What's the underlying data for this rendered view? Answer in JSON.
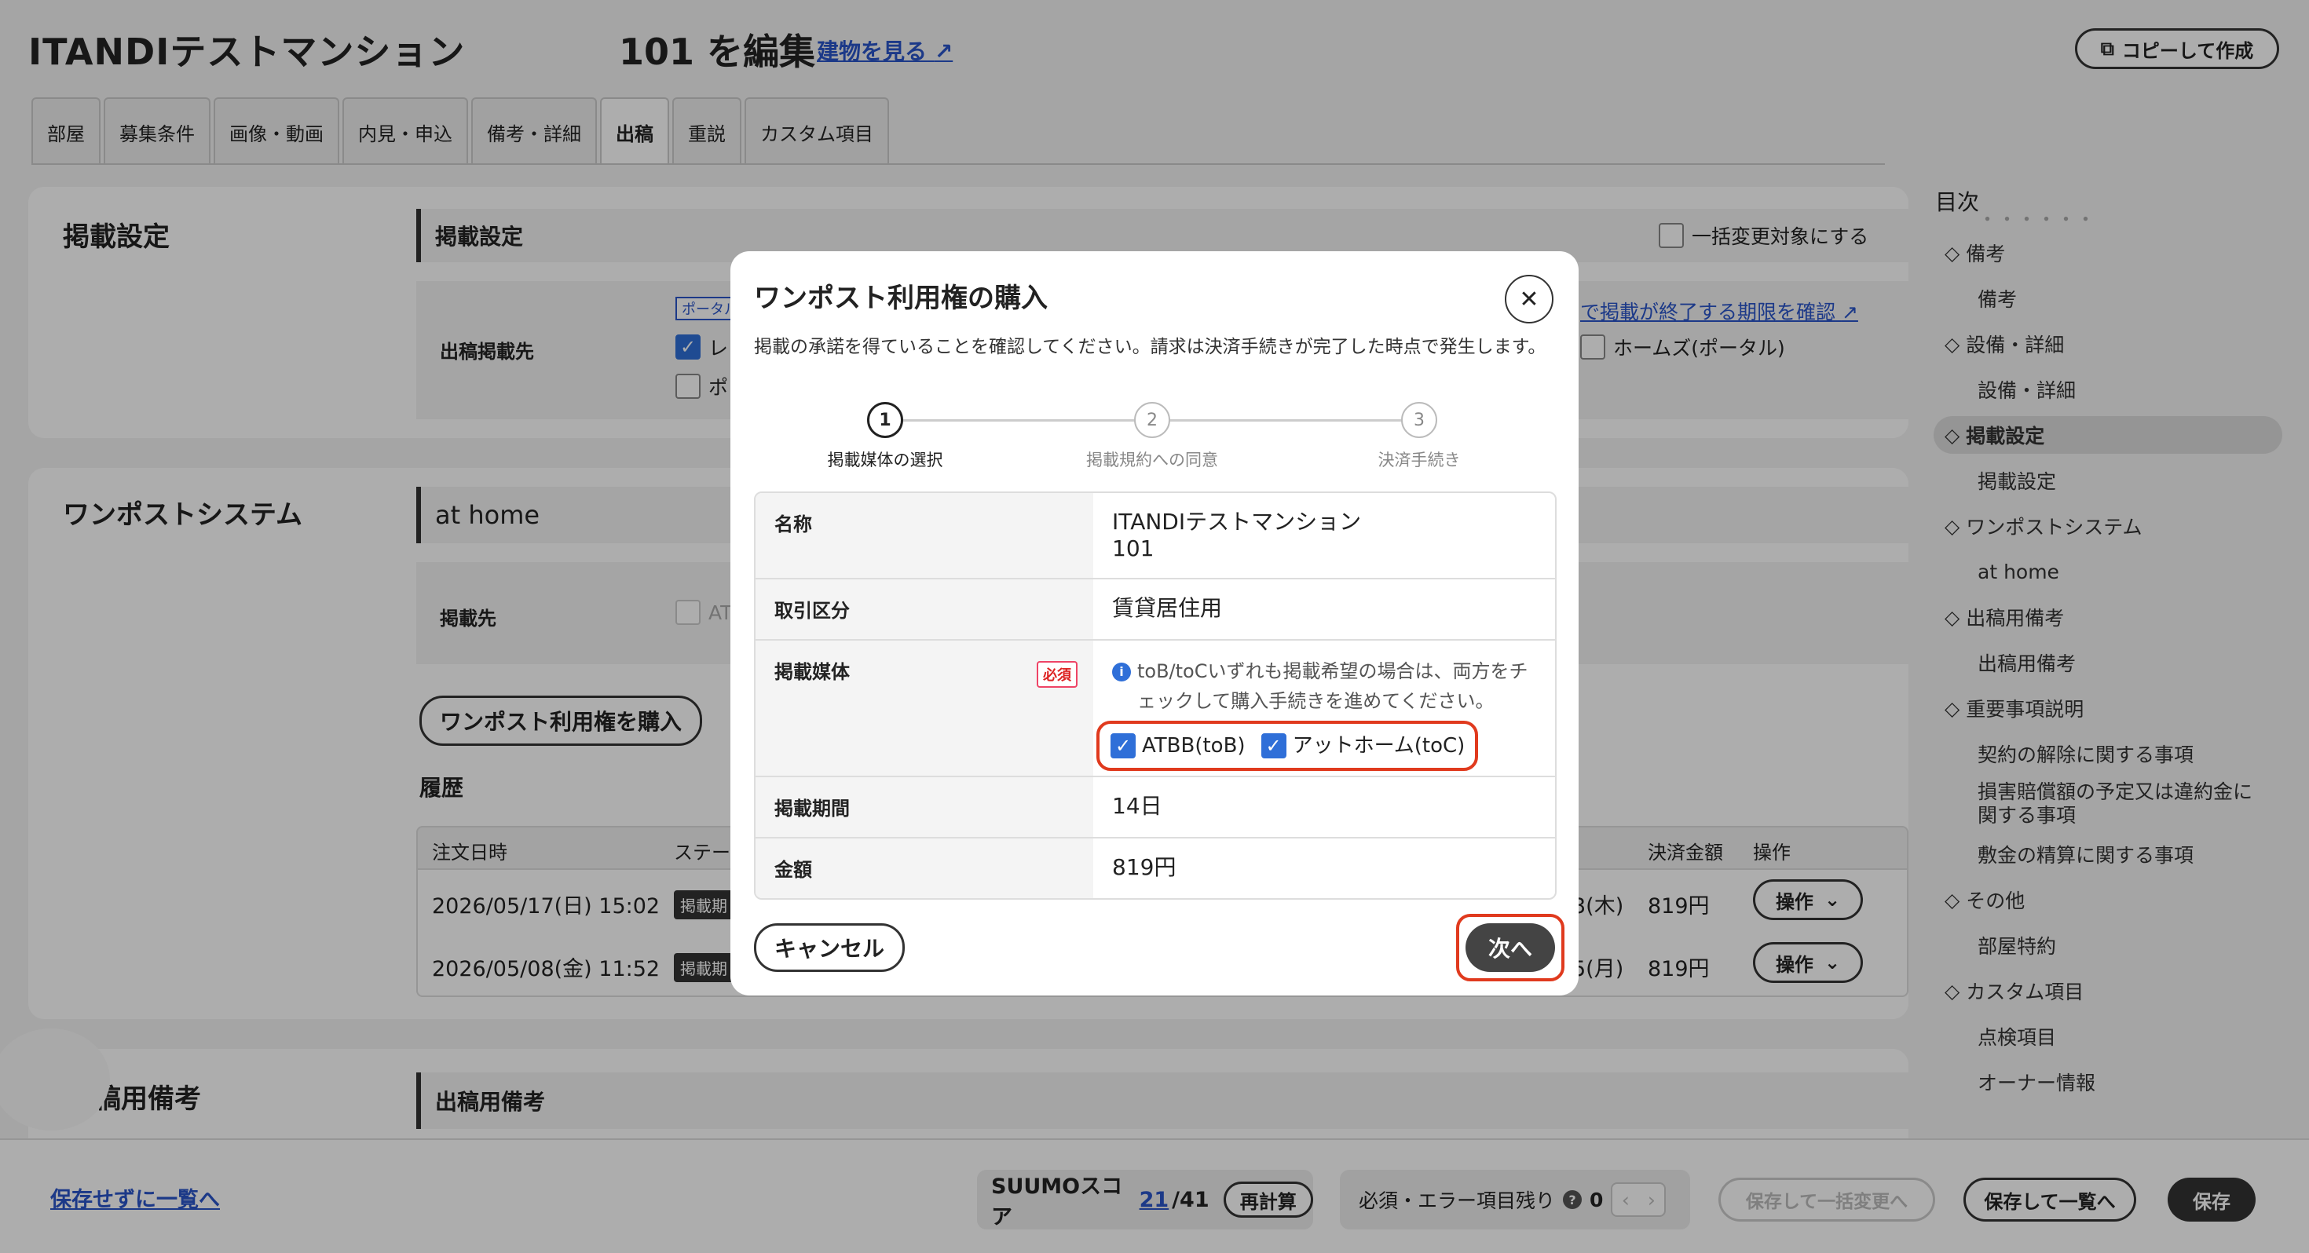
{
  "header": {
    "property_name": "ITANDIテストマンション",
    "room_edit": "101 を編集",
    "building_link": "建物を見る",
    "copy_button": "コピーして作成"
  },
  "tabs": [
    "部屋",
    "募集条件",
    "画像・動画",
    "内見・申込",
    "備考・詳細",
    "出稿",
    "重説",
    "カスタム項目"
  ],
  "active_tab": "出稿",
  "listing_settings": {
    "card_title": "掲載設定",
    "section_title": "掲載設定",
    "bulk_change_label": "一括変更対象にする",
    "row_label": "出稿掲載先",
    "portal_tag": "ポータル",
    "option_1": "レ",
    "option_2": "ポ",
    "deadline_link": "で掲載が終了する期限を確認",
    "homes_option": "ホームズ(ポータル)"
  },
  "onepost": {
    "card_title": "ワンポストシステム",
    "section_title": "at home",
    "row_label": "掲載先",
    "partial_option": "AT",
    "buy_button": "ワンポスト利用権を購入",
    "history_title": "履歴",
    "columns": {
      "order_date": "注文日時",
      "status": "ステー",
      "amount": "決済金額",
      "action": "操作"
    },
    "rows": [
      {
        "date": "2026/05/17(日) 15:02",
        "tag": "掲載期",
        "end": "3(木)",
        "amount": "819円",
        "action": "操作"
      },
      {
        "date": "2026/05/08(金) 11:52",
        "tag": "掲載期",
        "end": "5(月)",
        "amount": "819円",
        "action": "操作"
      }
    ]
  },
  "remarks": {
    "card_title": "稿用備考",
    "section_title": "出稿用備考"
  },
  "toc": {
    "title": "目次",
    "items": [
      {
        "label": "・・・・・・",
        "level": 1
      },
      {
        "label": "備考",
        "level": 0
      },
      {
        "label": "備考",
        "level": 1
      },
      {
        "label": "設備・詳細",
        "level": 0
      },
      {
        "label": "設備・詳細",
        "level": 1
      },
      {
        "label": "掲載設定",
        "level": 0,
        "active": true
      },
      {
        "label": "掲載設定",
        "level": 1
      },
      {
        "label": "ワンポストシステム",
        "level": 0
      },
      {
        "label": "at home",
        "level": 1
      },
      {
        "label": "出稿用備考",
        "level": 0
      },
      {
        "label": "出稿用備考",
        "level": 1
      },
      {
        "label": "重要事項説明",
        "level": 0
      },
      {
        "label": "契約の解除に関する事項",
        "level": 1
      },
      {
        "label": "損害賠償額の予定又は違約金に関する事項",
        "level": 1
      },
      {
        "label": "敷金の精算に関する事項",
        "level": 1
      },
      {
        "label": "その他",
        "level": 0
      },
      {
        "label": "部屋特約",
        "level": 1
      },
      {
        "label": "カスタム項目",
        "level": 0
      },
      {
        "label": "点検項目",
        "level": 1
      },
      {
        "label": "オーナー情報",
        "level": 1
      }
    ]
  },
  "footer": {
    "back_without_save": "保存せずに一覧へ",
    "suumo_label": "SUUMOスコア",
    "suumo_score": "21",
    "suumo_total": "/41",
    "recalc_button": "再計算",
    "remaining_label": "必須・エラー項目残り",
    "remaining_count": "0",
    "save_bulk_button": "保存して一括変更へ",
    "save_list_button": "保存して一覧へ",
    "save_button": "保存"
  },
  "modal": {
    "title": "ワンポスト利用権の購入",
    "description": "掲載の承諾を得ていることを確認してください。請求は決済手続きが完了した時点で発生します。",
    "steps": [
      {
        "num": "1",
        "label": "掲載媒体の選択"
      },
      {
        "num": "2",
        "label": "掲載規約への同意"
      },
      {
        "num": "3",
        "label": "決済手続き"
      }
    ],
    "rows": {
      "name_label": "名称",
      "name_line1": "ITANDIテストマンション",
      "name_line2": "101",
      "type_label": "取引区分",
      "type_value": "賃貸居住用",
      "media_label": "掲載媒体",
      "required_badge": "必須",
      "media_note": "toB/toCいずれも掲載希望の場合は、両方をチェックして購入手続きを進めてください。",
      "media_option_1": "ATBB(toB)",
      "media_option_2": "アットホーム(toC)",
      "period_label": "掲載期間",
      "period_value": "14日",
      "price_label": "金額",
      "price_value": "819円"
    },
    "cancel_button": "キャンセル",
    "next_button": "次へ"
  }
}
